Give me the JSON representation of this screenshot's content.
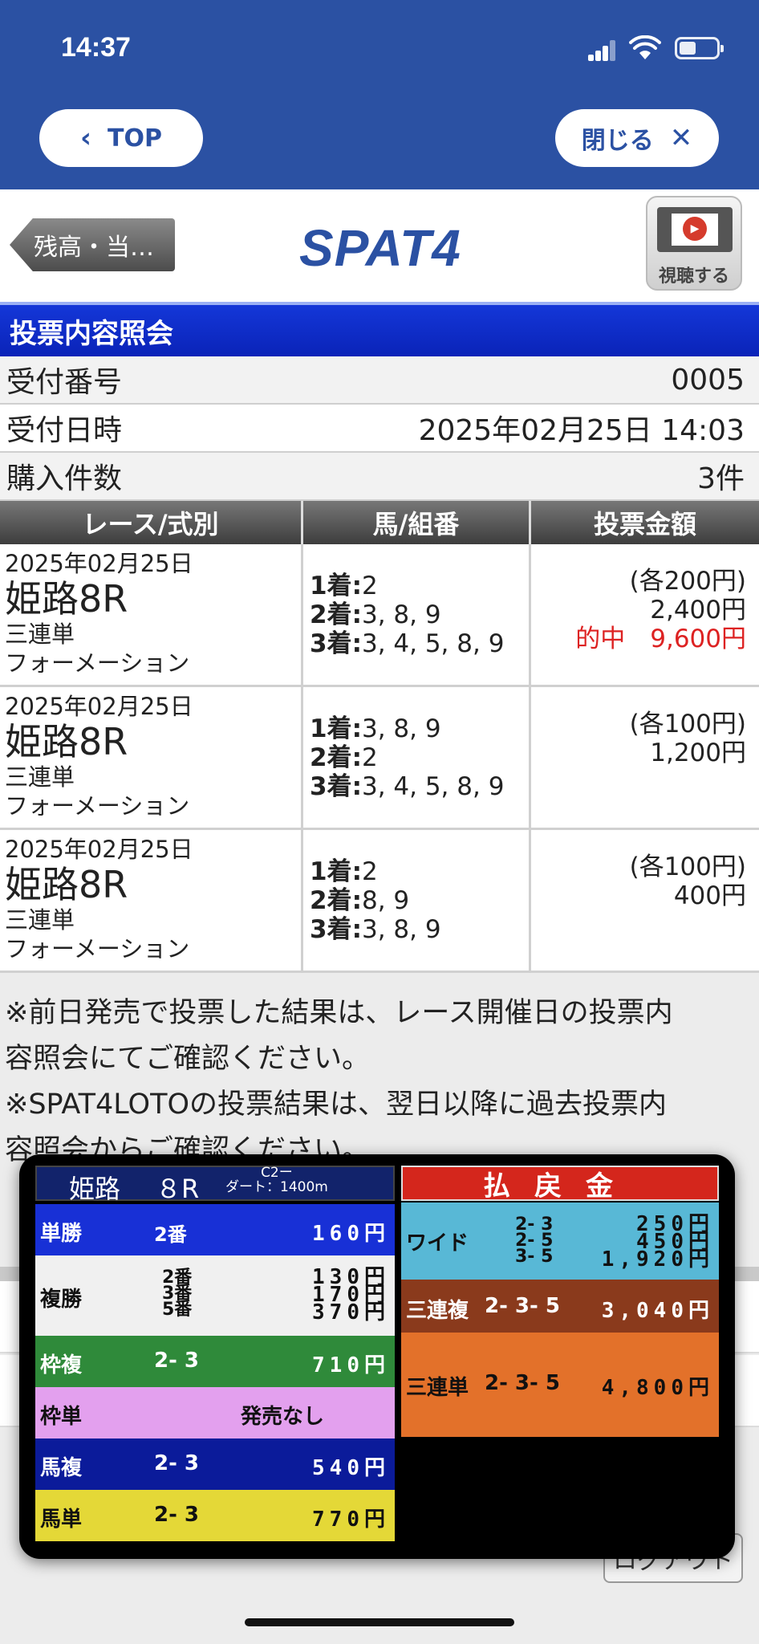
{
  "status": {
    "time": "14:37"
  },
  "nav": {
    "top_label": "TOP",
    "close_label": "閉じる"
  },
  "header": {
    "back_label": "残高・当…",
    "logo": "SPAT4",
    "watch_label": "視聴する"
  },
  "title": "投票内容照会",
  "info": [
    {
      "label": "受付番号",
      "value": "0005"
    },
    {
      "label": "受付日時",
      "value": "2025年02月25日 14:03"
    },
    {
      "label": "購入件数",
      "value": "3件"
    }
  ],
  "table": {
    "headers": [
      "レース/式別",
      "馬/組番",
      "投票金額"
    ],
    "rows": [
      {
        "date": "2025年02月25日",
        "race": "姫路8R",
        "type": "三連単",
        "method": "フォーメーション",
        "p1": "1着:",
        "v1": "2",
        "p2": "2着:",
        "v2": "3, 8, 9",
        "p3": "3着:",
        "v3": "3, 4, 5, 8, 9",
        "unit": "(各200円)",
        "total": "2,400円",
        "hit": "的中　9,600円"
      },
      {
        "date": "2025年02月25日",
        "race": "姫路8R",
        "type": "三連単",
        "method": "フォーメーション",
        "p1": "1着:",
        "v1": "3, 8, 9",
        "p2": "2着:",
        "v2": "2",
        "p3": "3着:",
        "v3": "3, 4, 5, 8, 9",
        "unit": "(各100円)",
        "total": "1,200円",
        "hit": ""
      },
      {
        "date": "2025年02月25日",
        "race": "姫路8R",
        "type": "三連単",
        "method": "フォーメーション",
        "p1": "1着:",
        "v1": "2",
        "p2": "2着:",
        "v2": "8, 9",
        "p3": "3着:",
        "v3": "3, 8, 9",
        "unit": "(各100円)",
        "total": "400円",
        "hit": ""
      }
    ]
  },
  "notes": {
    "line1": "※前日発売で投票した結果は、レース開催日の投票内",
    "line2": "容照会にてご確認ください。",
    "line3": "※SPAT4LOTOの投票結果は、翌日以降に過去投票内",
    "line4": "容照会からご確認ください。"
  },
  "background": {
    "logout_label": "ログアウト"
  },
  "video": {
    "venue": "姫路",
    "race_no": "８R",
    "class": "C2ー",
    "distance": "ダート：1400m",
    "payout_title": "払戻金",
    "left": [
      {
        "name": "単勝",
        "combo": "2番",
        "amount": "160円",
        "color": "#1830d6"
      },
      {
        "name": "複勝",
        "combos": [
          "2番",
          "3番",
          "5番"
        ],
        "amounts": [
          "130円",
          "170円",
          "370円"
        ],
        "color": "#f0f0f0"
      },
      {
        "name": "枠複",
        "combo": "2- 3",
        "amount": "710円",
        "color": "#2f8a3a"
      },
      {
        "name": "枠単",
        "note": "発売なし",
        "color": "#e3a0ee"
      },
      {
        "name": "馬複",
        "combo": "2- 3",
        "amount": "540円",
        "color": "#0b1b9a"
      },
      {
        "name": "馬単",
        "combo": "2- 3",
        "amount": "770円",
        "color": "#e4d837"
      }
    ],
    "right": [
      {
        "name": "ワイド",
        "combos": [
          "2- 3",
          "2- 5",
          "3- 5"
        ],
        "amounts": [
          "250円",
          "450円",
          "1,920円"
        ],
        "color": "#58b8d6"
      },
      {
        "name": "三連複",
        "combo": "2- 3- 5",
        "amount": "3,040円",
        "color": "#8a3a1c"
      },
      {
        "name": "三連単",
        "combo": "2- 3- 5",
        "amount": "4,800円",
        "color": "#e3712a"
      }
    ]
  }
}
